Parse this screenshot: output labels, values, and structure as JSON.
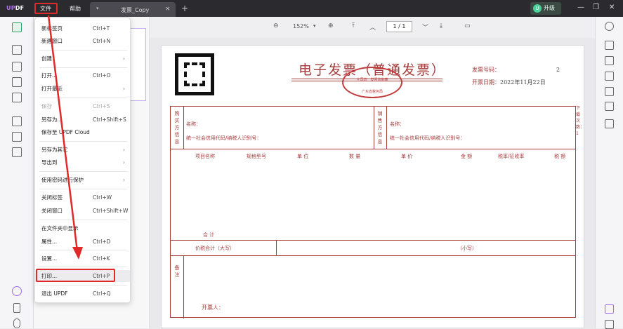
{
  "titlebar": {
    "logo_u": "UP",
    "logo_rest": "DF",
    "menu_file": "文件",
    "menu_help": "帮助",
    "tab_title": "发票_Copy",
    "tab_close": "×",
    "tab_dropdown": "▾",
    "new_tab": "+",
    "upgrade_avatar": "U",
    "upgrade_label": "升级",
    "minimize": "—",
    "restore": "❐",
    "close": "✕"
  },
  "toolbar": {
    "zoom_out": "⊖",
    "zoom_value": "152%",
    "zoom_dropdown": "▾",
    "zoom_in": "⊕",
    "first_page": "⤒",
    "prev_page": "︿",
    "page_indicator": "1 / 1",
    "next_page": "﹀",
    "last_page": "⤓",
    "comment": "▭"
  },
  "file_menu": {
    "items": [
      {
        "label": "新标签页",
        "shortcut": "Ctrl+T"
      },
      {
        "label": "新建窗口",
        "shortcut": "Ctrl+N"
      },
      {
        "label": "创建",
        "shortcut": ""
      },
      {
        "label": "打开...",
        "shortcut": "Ctrl+O"
      },
      {
        "label": "打开最近",
        "shortcut": ""
      },
      {
        "label": "保存",
        "shortcut": "Ctrl+S"
      },
      {
        "label": "另存为...",
        "shortcut": "Ctrl+Shift+S"
      },
      {
        "label": "保存至 UPDF Cloud",
        "shortcut": ""
      },
      {
        "label": "另存为其它",
        "shortcut": ""
      },
      {
        "label": "导出到",
        "shortcut": ""
      },
      {
        "label": "使用密码进行保护",
        "shortcut": ""
      },
      {
        "label": "关闭标签",
        "shortcut": "Ctrl+W"
      },
      {
        "label": "关闭窗口",
        "shortcut": "Ctrl+Shift+W"
      },
      {
        "label": "在文件夹中显示",
        "shortcut": ""
      },
      {
        "label": "属性...",
        "shortcut": "Ctrl+D"
      },
      {
        "label": "设置...",
        "shortcut": "Ctrl+K"
      },
      {
        "label": "打印...",
        "shortcut": "Ctrl+P"
      },
      {
        "label": "退出 UPDF",
        "shortcut": "Ctrl+Q"
      }
    ],
    "submenu_arrow": "›"
  },
  "invoice": {
    "title": "电子发票（普通发票）",
    "seal_top": "全国统一发票监制章",
    "seal_bottom": "广东省税务局",
    "invoice_no_label": "发票号码：",
    "invoice_no_value": "2",
    "date_label": "开票日期：",
    "date_value": "2022年11月22日",
    "buyer_side": "购买方信息",
    "seller_side": "销售方信息",
    "name_label": "名称：",
    "tax_id_label": "统一社会信用代码/纳税人识别号：",
    "col_item": "项目名称",
    "col_spec": "规格型号",
    "col_unit": "单 位",
    "col_qty": "数 量",
    "col_price": "单 价",
    "col_amount": "金 额",
    "col_rate": "税率/征收率",
    "col_tax": "税 额",
    "total_label": "合 计",
    "total_in_words": "价税合计（大写）",
    "total_small": "（小写）",
    "remarks": "备注",
    "drawer": "开票人：",
    "side_text": "下载次数：1"
  },
  "colors": {
    "accent_red": "#e02a2a",
    "invoice_red": "#a63b3b",
    "titlebar_bg": "#2b2b2f",
    "upgrade_green": "#4ad39a"
  }
}
